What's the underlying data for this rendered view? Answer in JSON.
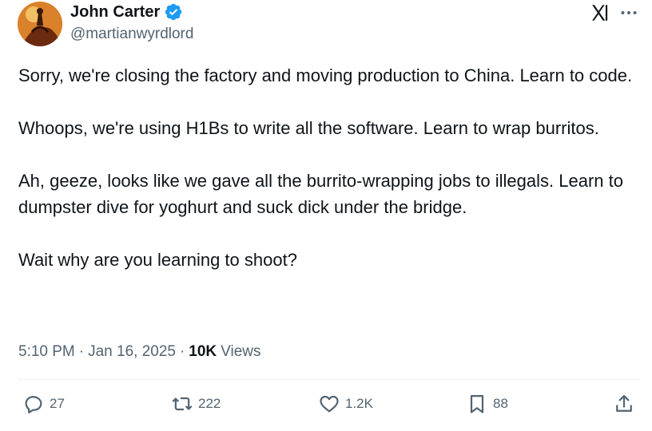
{
  "author": {
    "name": "John Carter",
    "handle": "@martianwyrdlord",
    "avatar_icon": "avatar",
    "verified": true,
    "verified_color": "#1d9bf0"
  },
  "tweet": {
    "paragraphs": [
      "Sorry, we're closing the factory and moving production to China. Learn to code.",
      "Whoops, we're using H1Bs to write all the software. Learn to wrap burritos.",
      "Ah, geeze, looks like we gave all the burrito-wrapping jobs to illegals. Learn to dumpster dive for yoghurt and suck dick under the bridge.",
      "Wait why are you learning to shoot?"
    ],
    "time": "5:10 PM",
    "date": "Jan 16, 2025",
    "separator": "·",
    "views_count": "10K",
    "views_label": "Views"
  },
  "actions": {
    "replies": "27",
    "reposts": "222",
    "likes": "1.2K",
    "bookmarks": "88"
  },
  "icons": [
    "x-logo-icon",
    "more-icon",
    "verified-icon",
    "reply-icon",
    "repost-icon",
    "like-icon",
    "bookmark-icon",
    "share-icon"
  ],
  "colors": {
    "text": "#0f1419",
    "secondary": "#536471",
    "accent": "#1d9bf0"
  }
}
